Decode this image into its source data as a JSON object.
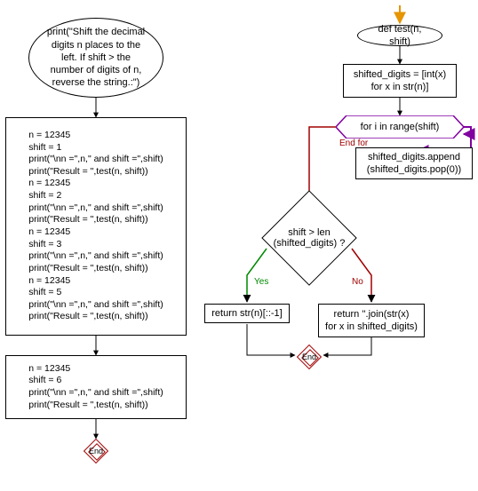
{
  "flow_left": {
    "start_ellipse": "print(\"Shift the decimal\ndigits n places to the\nleft. If shift > the\nnumber of digits of n,\nreverse the string.:\")",
    "block1": "n = 12345\nshift = 1\nprint(\"\\nn =\",n,\" and shift =\",shift)\nprint(\"Result = \",test(n, shift))\nn = 12345\nshift = 2\nprint(\"\\nn =\",n,\" and shift =\",shift)\nprint(\"Result = \",test(n, shift))\nn = 12345\nshift = 3\nprint(\"\\nn =\",n,\" and shift =\",shift)\nprint(\"Result = \",test(n, shift))\nn = 12345\nshift = 5\nprint(\"\\nn =\",n,\" and shift =\",shift)\nprint(\"Result = \",test(n, shift))",
    "block2": "n = 12345\nshift = 6\nprint(\"\\nn =\",n,\" and shift =\",shift)\nprint(\"Result = \",test(n, shift))",
    "end_label": "End"
  },
  "flow_right": {
    "def_ellipse": "def test(n, shift)",
    "init_rect": "shifted_digits = [int(x)\nfor x in str(n)]",
    "loop_hex": "for i in range(shift)",
    "loop_body": "shifted_digits.append\n(shifted_digits.pop(0))",
    "endfor_label": "End for",
    "cond_diamond": "shift > len\n(shifted_digits) ?",
    "yes_label": "Yes",
    "no_label": "No",
    "ret_yes": "return str(n)[::-1]",
    "ret_no": "return ''.join(str(x)\nfor x in shifted_digits)",
    "end_label": "End"
  }
}
